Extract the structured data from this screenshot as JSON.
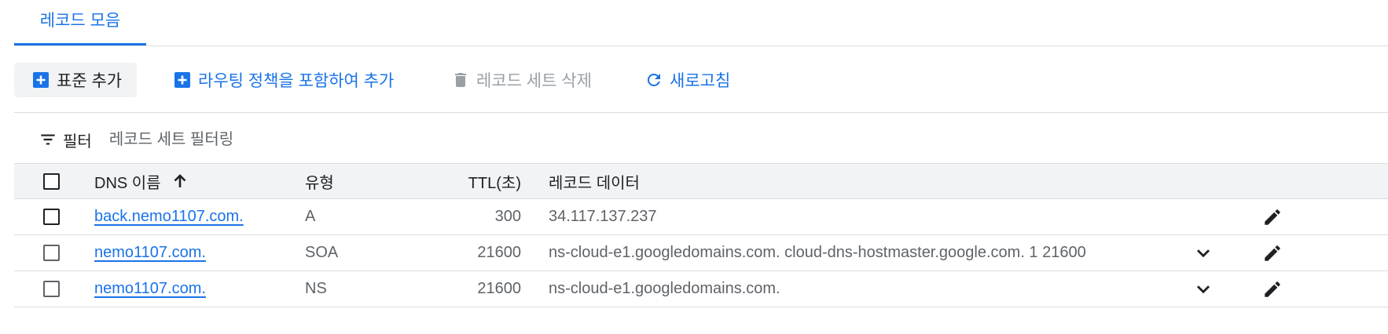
{
  "tabs": [
    {
      "label": "레코드 모음",
      "active": true
    }
  ],
  "toolbar": {
    "add_standard_label": "표준 추가",
    "add_routing_label": "라우팅 정책을 포함하여 추가",
    "delete_label": "레코드 세트 삭제",
    "refresh_label": "새로고침"
  },
  "filter": {
    "label": "필터",
    "placeholder": "레코드 세트 필터링"
  },
  "table": {
    "columns": {
      "name": "DNS 이름",
      "type": "유형",
      "ttl": "TTL(초)",
      "data": "레코드 데이터"
    },
    "rows": [
      {
        "name": "back.nemo1107.com.",
        "type": "A",
        "ttl": "300",
        "data": "34.117.137.237",
        "expandable": false
      },
      {
        "name": "nemo1107.com.",
        "type": "SOA",
        "ttl": "21600",
        "data": "ns-cloud-e1.googledomains.com. cloud-dns-hostmaster.google.com. 1 21600",
        "expandable": true
      },
      {
        "name": "nemo1107.com.",
        "type": "NS",
        "ttl": "21600",
        "data": "ns-cloud-e1.googledomains.com.",
        "expandable": true
      }
    ]
  },
  "colors": {
    "accent": "#1a73e8",
    "text": "#202124",
    "muted": "#5f6368",
    "disabled": "#9aa0a6",
    "divider": "#dadce0",
    "header_bg": "#f1f3f4"
  },
  "icons": {
    "add": "add-box-icon",
    "delete": "trash-icon",
    "refresh": "refresh-icon",
    "filter": "filter-icon",
    "sort": "arrow-up-icon",
    "expand": "chevron-down-icon",
    "edit": "pencil-icon"
  }
}
